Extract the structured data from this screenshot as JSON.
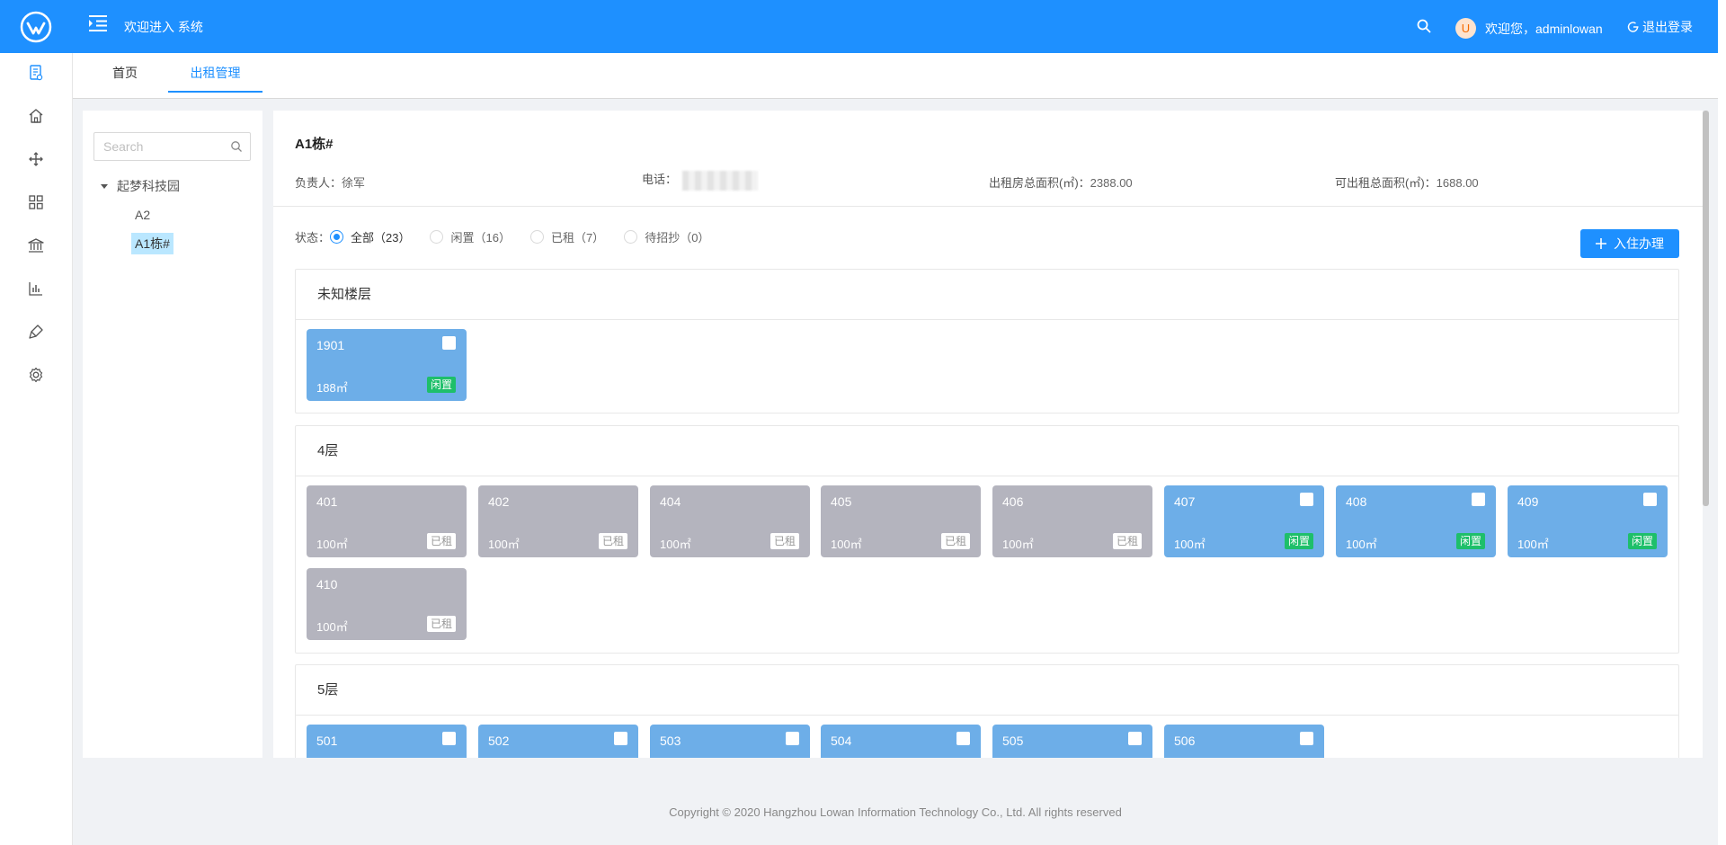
{
  "header": {
    "welcome": "欢迎进入 系统",
    "avatar_letter": "U",
    "greeting": "欢迎您，adminlowan",
    "logout": "退出登录",
    "bg_color": "#1e90ff"
  },
  "tabs": [
    {
      "label": "首页",
      "active": false
    },
    {
      "label": "出租管理",
      "active": true
    }
  ],
  "rail_icons": [
    "document-icon",
    "home-icon",
    "move-icon",
    "grid-icon",
    "bank-icon",
    "chart-icon",
    "brush-icon",
    "settings-icon"
  ],
  "tree": {
    "search_placeholder": "Search",
    "root": "起梦科技园",
    "children": [
      "A2",
      "A1栋#"
    ],
    "selected": "A1栋#"
  },
  "building": {
    "title": "A1栋#",
    "manager_label": "负责人：",
    "manager": "徐军",
    "phone_label": "电话：",
    "total_area_label": "出租房总面积(㎡)：",
    "total_area": "2388.00",
    "rentable_area_label": "可出租总面积(㎡)：",
    "rentable_area": "1688.00"
  },
  "status": {
    "label": "状态：",
    "options": [
      {
        "text": "全部（23）",
        "checked": true
      },
      {
        "text": "闲置（16）",
        "checked": false
      },
      {
        "text": "已租（7）",
        "checked": false
      },
      {
        "text": "待招抄（0）",
        "checked": false
      }
    ]
  },
  "checkin_button": "入住办理",
  "floors": [
    {
      "name": "未知楼层",
      "rooms": [
        {
          "num": "1901",
          "area": "188㎡",
          "status": "闲置",
          "free": true
        }
      ]
    },
    {
      "name": "4层",
      "rooms": [
        {
          "num": "401",
          "area": "100㎡",
          "status": "已租",
          "free": false
        },
        {
          "num": "402",
          "area": "100㎡",
          "status": "已租",
          "free": false
        },
        {
          "num": "404",
          "area": "100㎡",
          "status": "已租",
          "free": false
        },
        {
          "num": "405",
          "area": "100㎡",
          "status": "已租",
          "free": false
        },
        {
          "num": "406",
          "area": "100㎡",
          "status": "已租",
          "free": false
        },
        {
          "num": "407",
          "area": "100㎡",
          "status": "闲置",
          "free": true
        },
        {
          "num": "408",
          "area": "100㎡",
          "status": "闲置",
          "free": true
        },
        {
          "num": "409",
          "area": "100㎡",
          "status": "闲置",
          "free": true
        },
        {
          "num": "410",
          "area": "100㎡",
          "status": "已租",
          "free": false
        }
      ]
    },
    {
      "name": "5层",
      "rooms": [
        {
          "num": "501",
          "area": "",
          "status": "",
          "free": true
        },
        {
          "num": "502",
          "area": "",
          "status": "",
          "free": true
        },
        {
          "num": "503",
          "area": "",
          "status": "",
          "free": true
        },
        {
          "num": "504",
          "area": "",
          "status": "",
          "free": true
        },
        {
          "num": "505",
          "area": "",
          "status": "",
          "free": true
        },
        {
          "num": "506",
          "area": "",
          "status": "",
          "free": true
        }
      ]
    }
  ],
  "footer": {
    "before": "Copyright ",
    "symbol": "©",
    "after": " 2020 Hangzhou Lowan Information Technology Co., Ltd. All rights reserved"
  }
}
